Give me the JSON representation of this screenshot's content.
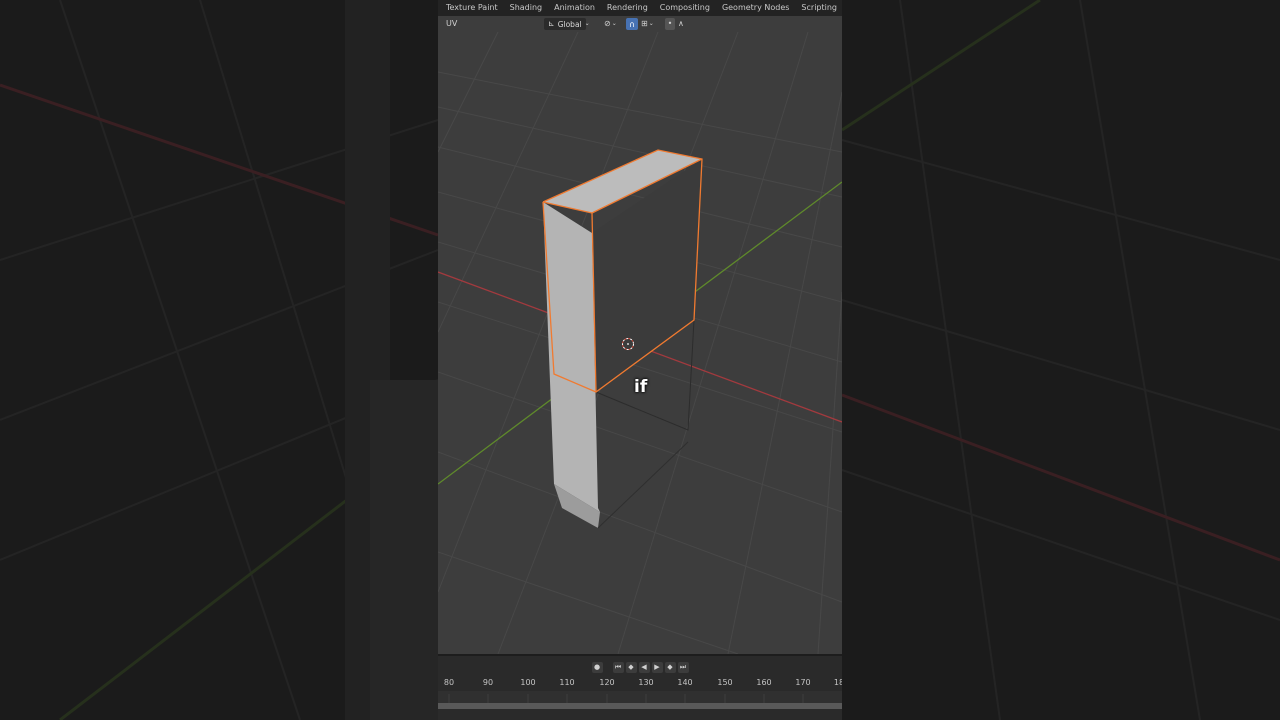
{
  "topbar": {
    "tabs": [
      "Texture Paint",
      "Shading",
      "Animation",
      "Rendering",
      "Compositing",
      "Geometry Nodes",
      "Scripting"
    ],
    "add_label": "+"
  },
  "header": {
    "uv_label": "UV",
    "orientation": "Global"
  },
  "viewport": {
    "subtitle": "if"
  },
  "timeline": {
    "frame_labels": [
      "80",
      "90",
      "100",
      "110",
      "120",
      "130",
      "140",
      "150",
      "160",
      "170",
      "18"
    ]
  },
  "colors": {
    "viewport_bg": "#3d3d3d",
    "grid": "#4a4a4a",
    "x_axis": "#a23a3e",
    "y_axis": "#5f8a2b",
    "selection": "#f07a30",
    "active_tool": "#4772b3"
  },
  "icons": {
    "orientation": "transform-orientation-icon",
    "pivot": "pivot-point-icon",
    "snap": "snap-magnet-icon",
    "proportional": "proportional-edit-icon",
    "cursor": "3d-cursor-icon"
  }
}
